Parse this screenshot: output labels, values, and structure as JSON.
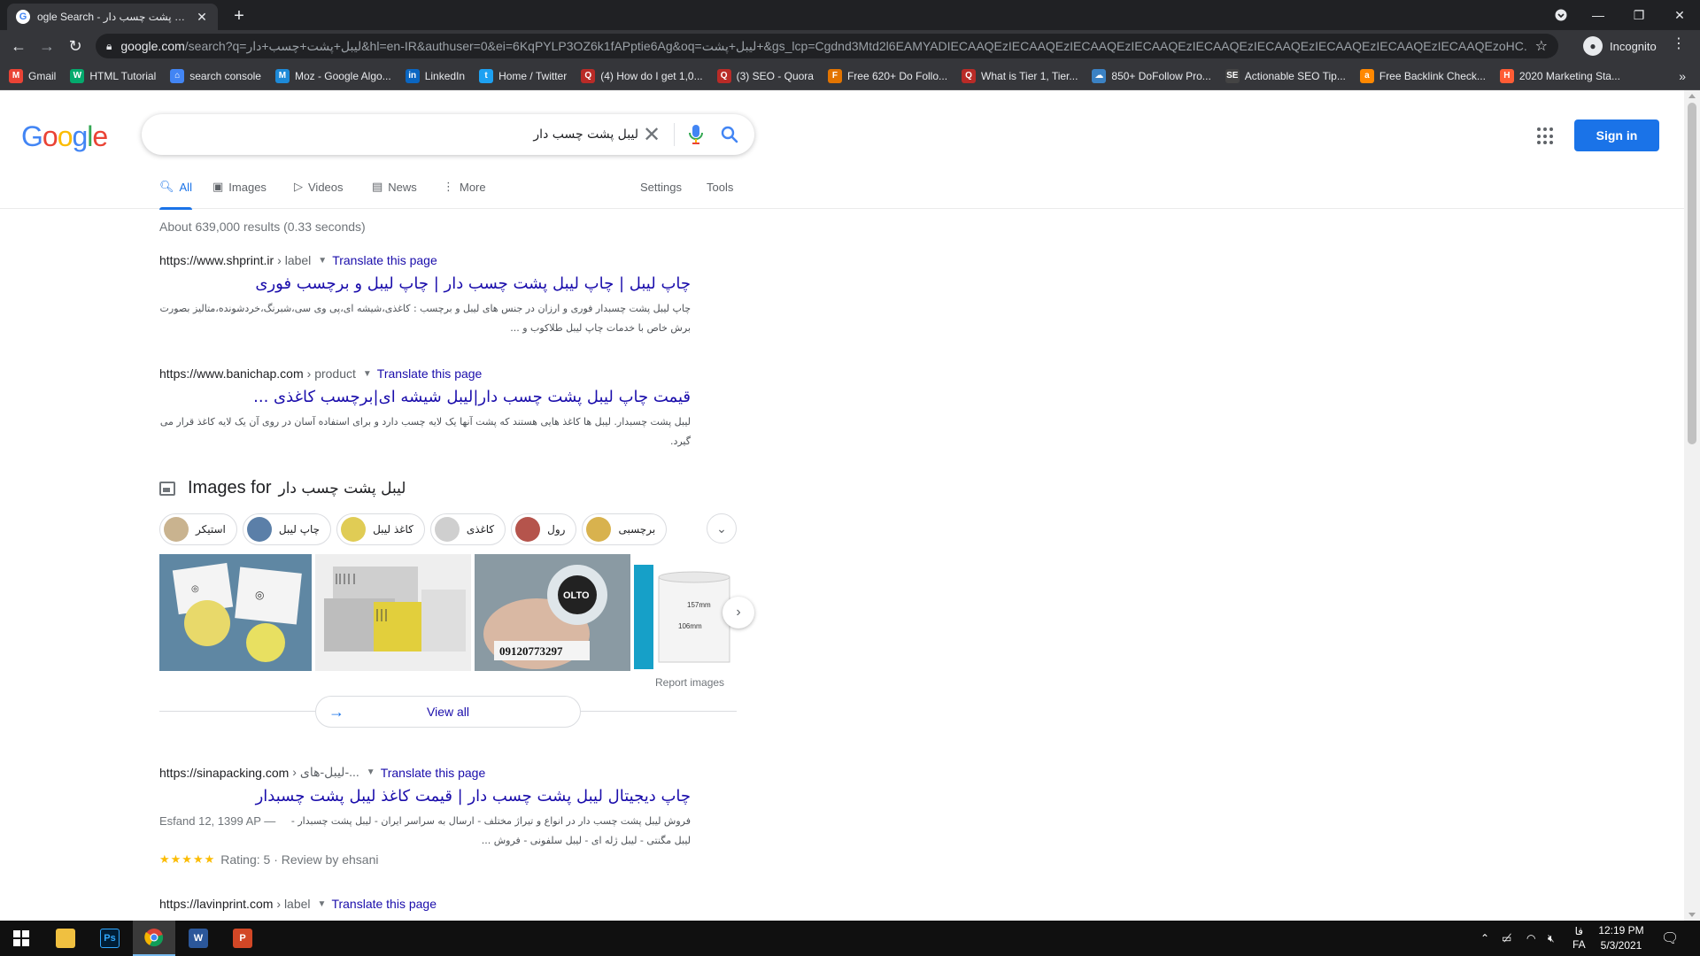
{
  "browser": {
    "tab_title": "Google Search - لیبل پشت چسب دار",
    "tab_title_visible": "ogle Search - لیبل پشت چسب دار",
    "url_host": "google.com",
    "url_rest": "/search?q=لیبل+پشت+چسب+دار&hl=en-IR&authuser=0&ei=6KqPYLP3OZ6k1fAPptie6Ag&oq=لیبل+پشت+&gs_lcp=Cgdnd3Mtd2l6EAMYADIECAAQEzIECAAQEzIECAAQEzIECAAQEzIECAAQEzIECAAQEzIECAAQEzIECAAQEzIECAAQEzoHC...",
    "incognito_label": "Incognito",
    "bookmarks": [
      {
        "label": "Gmail",
        "icon": "gmail-icon",
        "color": "#ea4335",
        "glyph": "M"
      },
      {
        "label": "HTML Tutorial",
        "icon": "w3schools-icon",
        "color": "#04aa6d",
        "glyph": "W"
      },
      {
        "label": "search console",
        "icon": "search-console-icon",
        "color": "#4285f4",
        "glyph": "⌂"
      },
      {
        "label": "Moz - Google Algo...",
        "icon": "moz-icon",
        "color": "#1d8ad8",
        "glyph": "M"
      },
      {
        "label": "LinkedIn",
        "icon": "linkedin-icon",
        "color": "#0a66c2",
        "glyph": "in"
      },
      {
        "label": "Home / Twitter",
        "icon": "twitter-icon",
        "color": "#1da1f2",
        "glyph": "t"
      },
      {
        "label": "(4) How do I get 1,0...",
        "icon": "quora-icon",
        "color": "#b92b27",
        "glyph": "Q"
      },
      {
        "label": "(3) SEO - Quora",
        "icon": "quora-icon",
        "color": "#b92b27",
        "glyph": "Q"
      },
      {
        "label": "Free 620+ Do Follo...",
        "icon": "site-icon",
        "color": "#e37400",
        "glyph": "F"
      },
      {
        "label": "What is Tier 1, Tier...",
        "icon": "quora-icon",
        "color": "#b92b27",
        "glyph": "Q"
      },
      {
        "label": "850+ DoFollow Pro...",
        "icon": "site-icon",
        "color": "#3b82c4",
        "glyph": "☁"
      },
      {
        "label": "Actionable SEO Tip...",
        "icon": "site-icon",
        "color": "#444444",
        "glyph": "SE"
      },
      {
        "label": "Free Backlink Check...",
        "icon": "ahrefs-icon",
        "color": "#ff8800",
        "glyph": "a"
      },
      {
        "label": "2020 Marketing Sta...",
        "icon": "hubspot-icon",
        "color": "#ff5c35",
        "glyph": "H"
      }
    ]
  },
  "google": {
    "logo": [
      "G",
      "o",
      "o",
      "g",
      "l",
      "e"
    ],
    "logo_colors": [
      "#4285f4",
      "#ea4335",
      "#fbbc05",
      "#4285f4",
      "#34a853",
      "#ea4335"
    ],
    "query": "لیبل پشت چسب دار",
    "sign_in": "Sign in",
    "tabs": [
      "All",
      "Images",
      "Videos",
      "News",
      "More"
    ],
    "settings": "Settings",
    "tools": "Tools",
    "stats": "About 639,000 results (0.33 seconds)",
    "results": [
      {
        "host": "https://www.shprint.ir",
        "path": "› label",
        "translate": "Translate this page",
        "title": "چاپ لیبل | چاپ لیبل پشت چسب دار | چاپ لیبل و برچسب فوری",
        "snippet": "چاپ لیبل پشت چسبدار فوری و ارزان در جنس های لیبل و برچسب : کاغذی،شیشه ای،پی وی سی،شبرنگ،خردشونده،متالیز بصورت برش خاص با خدمات چاپ لیبل طلاکوب و ..."
      },
      {
        "host": "https://www.banichap.com",
        "path": "› product",
        "translate": "Translate this page",
        "title": "قیمت چاپ لیبل پشت چسب دار|لیبل شیشه ای|برچسب کاغذی ...",
        "snippet": "لیبل پشت چسبدار. لیبل ها کاغذ هایی هستند که پشت آنها یک لایه چسب دارد و برای استفاده آسان در روی آن یک لایه کاغذ قرار می گیرد."
      },
      {
        "host": "https://sinapacking.com",
        "path": "› لیبل-های-...",
        "translate": "Translate this page",
        "title": "چاپ دیجیتال لیبل پشت چسب دار | قیمت کاغذ لیبل پشت چسبدار",
        "date": "Esfand 12, 1399 AP —",
        "snippet": "فروش لیبل پشت چسب دار در انواع و تیراژ مختلف - ارسال به سراسر ایران - لیبل پشت چسبدار - لیبل مگنتی - لیبل ژله ای - لیبل سلفونی - فروش ...",
        "stars": "★★★★★",
        "rating": "Rating: 5 · Review by ehsani"
      },
      {
        "host": "https://lavinprint.com",
        "path": "› label",
        "translate": "Translate this page"
      }
    ],
    "images": {
      "heading": "Images for",
      "query": "لیبل پشت چسب دار",
      "chips": [
        "استیکر",
        "چاپ لیبل",
        "کاغذ لیبل",
        "کاغذی",
        "رول",
        "برچسبی"
      ],
      "phone_text": "09120773297",
      "roll_dims": [
        "157mm",
        "106mm"
      ],
      "report": "Report images",
      "view_all": "View all"
    }
  },
  "taskbar": {
    "lang": "FA",
    "lang_fa": "فا",
    "time": "12:19 PM",
    "date": "5/3/2021"
  }
}
